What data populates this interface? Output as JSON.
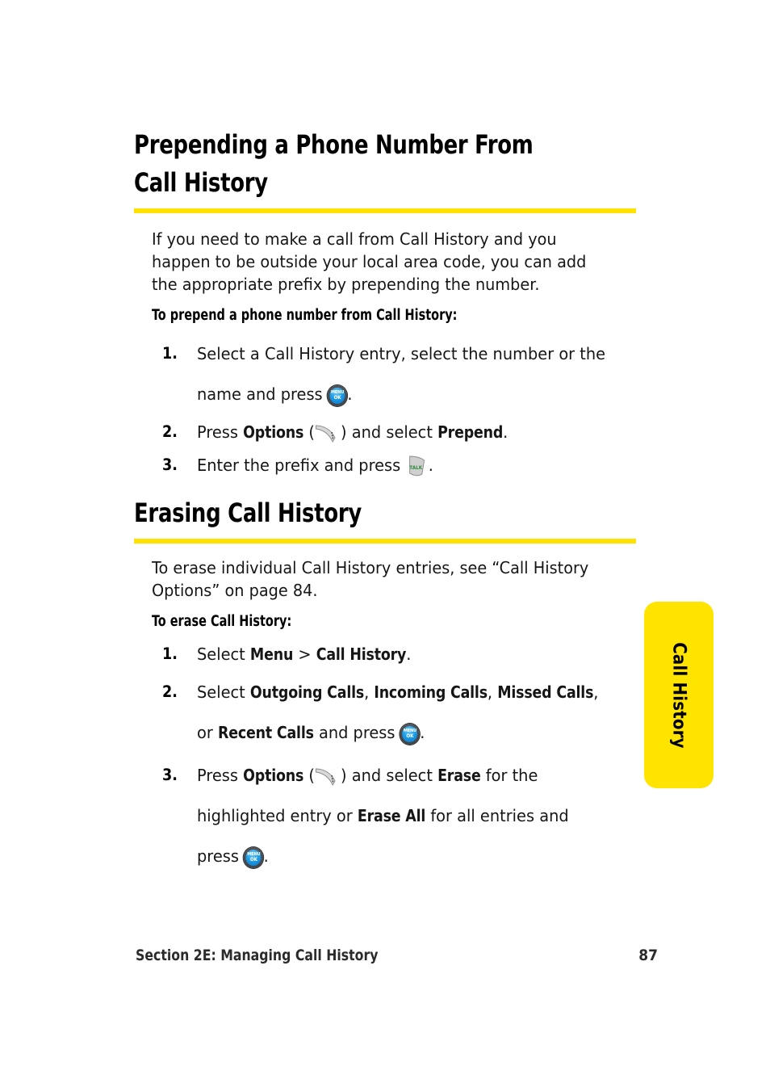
{
  "page": {
    "accent_yellow": "#FFE200",
    "tab_yellow": "#FFE400",
    "text_color": "#161616"
  },
  "sections": [
    {
      "heading_line1": "Prepending a Phone Number From",
      "heading_line2": "Call History",
      "paragraph": "If you need to make a call from Call History and you happen to be outside your local area code, you can add the appropriate prefix by prepending the number.",
      "lead_in": "To prepend a phone number from Call History:",
      "steps": [
        {
          "number": "1.",
          "parts": [
            {
              "text": "Select a Call History entry, select the number or the name and press ",
              "bold": false
            },
            {
              "icon": "menu-ok-key-icon"
            },
            {
              "text": ".",
              "bold": false
            }
          ]
        },
        {
          "number": "2.",
          "parts": [
            {
              "text": "Press ",
              "bold": false
            },
            {
              "text": "Options",
              "bold": true
            },
            {
              "text": " (",
              "bold": false
            },
            {
              "icon": "soft-key-icon"
            },
            {
              "text": ") and select ",
              "bold": false
            },
            {
              "text": "Prepend",
              "bold": true
            },
            {
              "text": ".",
              "bold": false
            }
          ]
        },
        {
          "number": "3.",
          "parts": [
            {
              "text": "Enter the prefix and press ",
              "bold": false
            },
            {
              "icon": "talk-key-icon"
            },
            {
              "text": ".",
              "bold": false
            }
          ]
        }
      ]
    },
    {
      "heading_line1": "Erasing Call History",
      "heading_line2": "",
      "paragraph": "To erase individual Call History entries, see “Call History Options” on page 84.",
      "lead_in": "To erase Call History:",
      "steps": [
        {
          "number": "1.",
          "parts": [
            {
              "text": "Select ",
              "bold": false
            },
            {
              "text": "Menu",
              "bold": true
            },
            {
              "text": " > ",
              "bold": false
            },
            {
              "text": "Call History",
              "bold": true
            },
            {
              "text": ".",
              "bold": false
            }
          ]
        },
        {
          "number": "2.",
          "parts": [
            {
              "text": "Select ",
              "bold": false
            },
            {
              "text": "Outgoing Calls",
              "bold": true
            },
            {
              "text": ", ",
              "bold": false
            },
            {
              "text": "Incoming Calls",
              "bold": true
            },
            {
              "text": ", ",
              "bold": false
            },
            {
              "text": "Missed Calls",
              "bold": true
            },
            {
              "text": ", or ",
              "bold": false
            },
            {
              "text": "Recent Calls",
              "bold": true
            },
            {
              "text": " and press ",
              "bold": false
            },
            {
              "icon": "menu-ok-key-icon"
            },
            {
              "text": ".",
              "bold": false
            }
          ]
        },
        {
          "number": "3.",
          "parts": [
            {
              "text": "Press ",
              "bold": false
            },
            {
              "text": "Options",
              "bold": true
            },
            {
              "text": " (",
              "bold": false
            },
            {
              "icon": "soft-key-icon"
            },
            {
              "text": ") and select ",
              "bold": false
            },
            {
              "text": "Erase",
              "bold": true
            },
            {
              "text": " for the highlighted entry or ",
              "bold": false
            },
            {
              "text": "Erase All",
              "bold": true
            },
            {
              "text": " for all entries and press ",
              "bold": false
            },
            {
              "icon": "menu-ok-key-icon"
            },
            {
              "text": ".",
              "bold": false
            }
          ]
        }
      ]
    }
  ],
  "side_tab": {
    "label": "Call History"
  },
  "footer": {
    "section": "Section 2E: Managing Call History",
    "page_number": "87"
  },
  "icons": {
    "menu_ok_key": {
      "line1": "MENU",
      "line2": "OK"
    },
    "talk_key": {
      "label": "TALK"
    },
    "soft_key": {
      "label": ""
    }
  }
}
